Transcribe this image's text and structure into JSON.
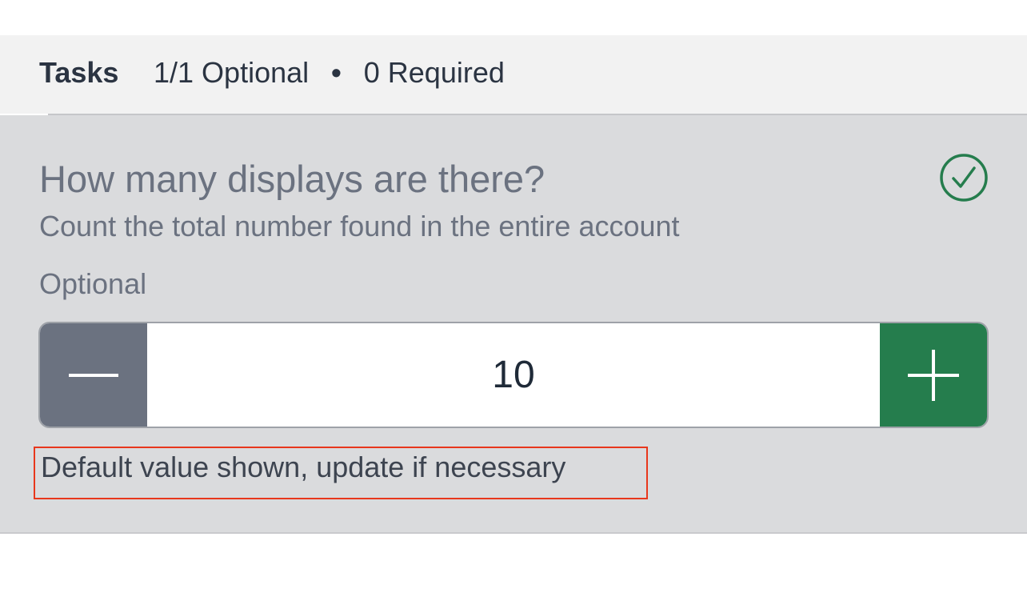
{
  "header": {
    "title": "Tasks",
    "optional_count": "1/1 Optional",
    "separator": "•",
    "required_count": "0 Required"
  },
  "task": {
    "question": "How many displays are there?",
    "description": "Count the total number found in the entire account",
    "requirement_label": "Optional",
    "status_icon": "check-circle-icon",
    "status_color": "#257d4d",
    "stepper": {
      "decrement_icon": "minus-icon",
      "increment_icon": "plus-icon",
      "value": "10",
      "decrement_color": "#6b7280",
      "increment_color": "#257d4d"
    },
    "hint": "Default value shown, update if necessary",
    "hint_highlight_color": "#e8371c"
  }
}
